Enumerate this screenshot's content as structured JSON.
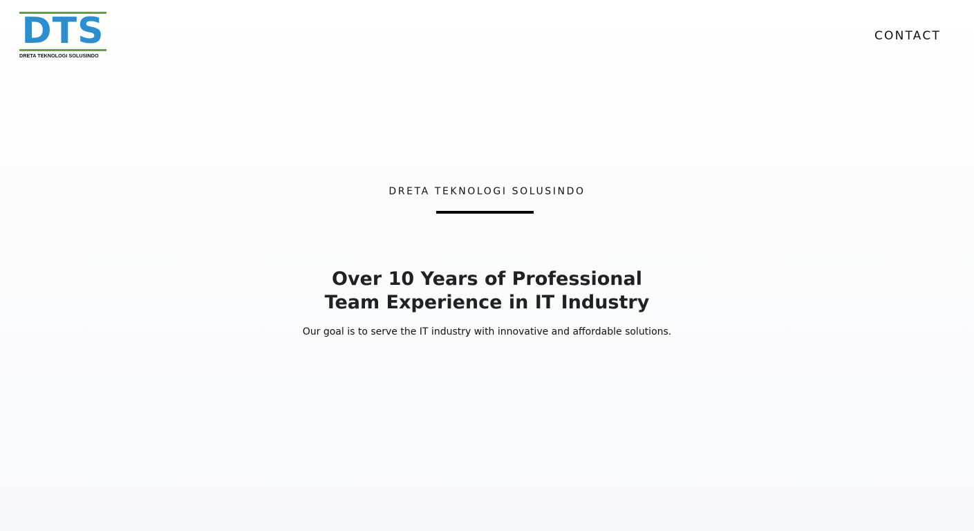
{
  "header": {
    "logo": {
      "letters": "DTS",
      "tagline": "DRETA TEKNOLOGI SOLUSINDO",
      "letter_color": "#2a8fd0",
      "bar_color": "#5aa832"
    },
    "nav": {
      "contact_label": "CONTACT"
    }
  },
  "hero": {
    "eyebrow": "DRETA TEKNOLOGI SOLUSINDO",
    "headline_line1": "Over 10 Years of Professional",
    "headline_line2": "Team Experience in IT Industry",
    "subtitle": "Our goal is to serve the IT industry with innovative and affordable solutions."
  }
}
